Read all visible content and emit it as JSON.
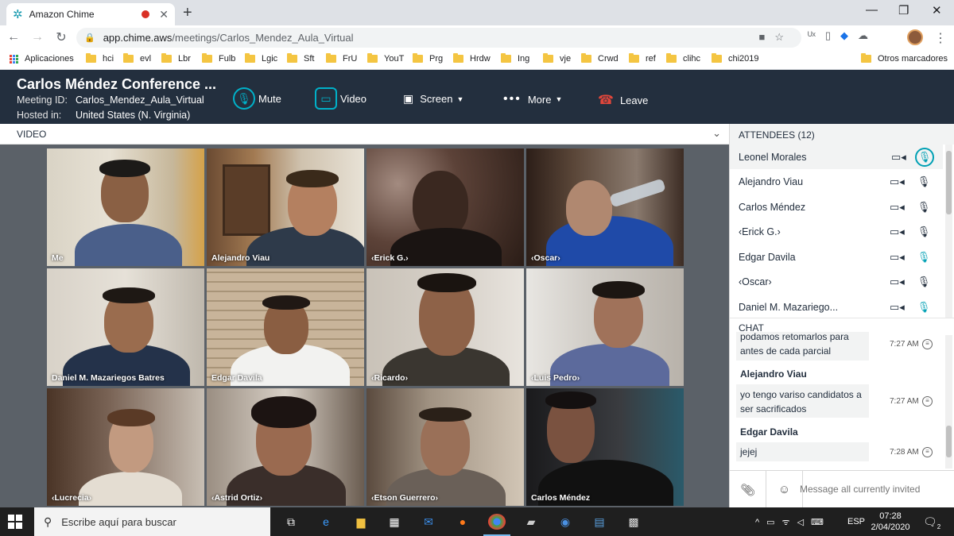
{
  "browser": {
    "tab_title": "Amazon Chime",
    "url_host": "app.chime.aws",
    "url_path": "/meetings/Carlos_Mendez_Aula_Virtual",
    "bookmarks": [
      "Aplicaciones",
      "hci",
      "evl",
      "Lbr",
      "Fulb",
      "Lgic",
      "Sft",
      "FrU",
      "YouT",
      "Prg",
      "Hrdw",
      "Ing",
      "vje",
      "Crwd",
      "ref",
      "clihc",
      "chi2019"
    ],
    "other_bookmarks": "Otros marcadores"
  },
  "meeting": {
    "title": "Carlos Méndez Conference ...",
    "id_label": "Meeting ID:",
    "id_value": "Carlos_Mendez_Aula_Virtual",
    "host_label": "Hosted in:",
    "host_value": "United States (N. Virginia)",
    "controls": {
      "mute": "Mute",
      "video": "Video",
      "screen": "Screen",
      "more": "More",
      "leave": "Leave"
    }
  },
  "video": {
    "section_label": "VIDEO",
    "tiles": [
      {
        "name": "Me"
      },
      {
        "name": "Alejandro Viau"
      },
      {
        "name": "‹Erick G.›"
      },
      {
        "name": "‹Oscar›"
      },
      {
        "name": "Daniel M. Mazariegos Batres"
      },
      {
        "name": "Edgar Davila"
      },
      {
        "name": "‹Ricardo›"
      },
      {
        "name": "‹Luis Pedro›"
      },
      {
        "name": "‹Lucrecia›"
      },
      {
        "name": "‹Astrid Ortiz›"
      },
      {
        "name": "‹Etson Guerrero›"
      },
      {
        "name": "Carlos Méndez"
      }
    ]
  },
  "attendees": {
    "header": "ATTENDEES (12)",
    "list": [
      {
        "name": "Leonel Morales",
        "mic": "active"
      },
      {
        "name": "Alejandro Viau",
        "mic": "muted"
      },
      {
        "name": "Carlos Méndez",
        "mic": "muted"
      },
      {
        "name": "‹Erick G.›",
        "mic": "muted"
      },
      {
        "name": "Edgar Davila",
        "mic": "on"
      },
      {
        "name": "‹Oscar›",
        "mic": "muted"
      },
      {
        "name": "Daniel M. Mazariego...",
        "mic": "on"
      }
    ]
  },
  "chat": {
    "header": "CHAT",
    "messages": [
      {
        "sender": "",
        "text": "podamos retomarlos para antes de cada parcial",
        "time": "7:27 AM"
      },
      {
        "sender": "Alejandro Viau",
        "text": "yo tengo variso candidatos a ser sacrificados",
        "time": "7:27 AM"
      },
      {
        "sender": "Edgar Davila",
        "text": "jejej",
        "time": "7:28 AM"
      }
    ],
    "input_placeholder": "Message all currently invited"
  },
  "taskbar": {
    "search_placeholder": "Escribe aquí para buscar",
    "lang": "ESP",
    "time": "07:28",
    "date": "2/04/2020",
    "notifications": "2"
  },
  "colors": {
    "chime_header": "#232f3e",
    "accent": "#00b1c9",
    "leave": "#e0463b"
  }
}
